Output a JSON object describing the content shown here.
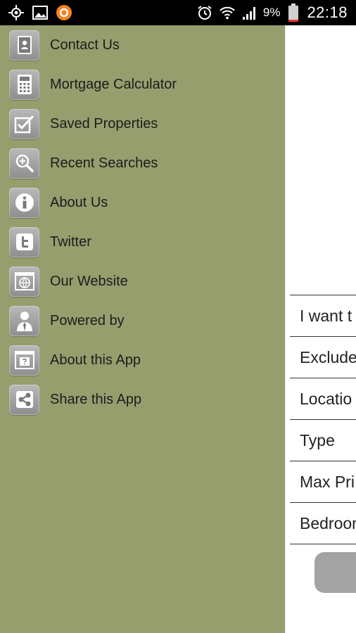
{
  "status_bar": {
    "battery_percent": "9%",
    "time": "22:18",
    "icons": [
      "gps-icon",
      "image-icon",
      "app-notification-icon",
      "alarm-icon",
      "wifi-icon",
      "signal-icon",
      "battery-icon"
    ]
  },
  "drawer": {
    "background_color": "#969e6e",
    "items": [
      {
        "label": "Contact Us",
        "icon": "contact-card-icon"
      },
      {
        "label": "Mortgage Calculator",
        "icon": "calculator-icon"
      },
      {
        "label": "Saved Properties",
        "icon": "checkbox-icon"
      },
      {
        "label": "Recent Searches",
        "icon": "magnifier-plus-icon"
      },
      {
        "label": "About Us",
        "icon": "info-icon"
      },
      {
        "label": "Twitter",
        "icon": "twitter-icon"
      },
      {
        "label": "Our Website",
        "icon": "website-icon"
      },
      {
        "label": "Powered by",
        "icon": "person-icon"
      },
      {
        "label": "About this App",
        "icon": "help-window-icon"
      },
      {
        "label": "Share this App",
        "icon": "share-icon"
      }
    ]
  },
  "search_form": {
    "rows": [
      {
        "label": "I want t"
      },
      {
        "label": "Exclude"
      },
      {
        "label": "Locatio"
      },
      {
        "label": "Type"
      },
      {
        "label": "Max Pri"
      },
      {
        "label": "Bedroon"
      }
    ]
  }
}
